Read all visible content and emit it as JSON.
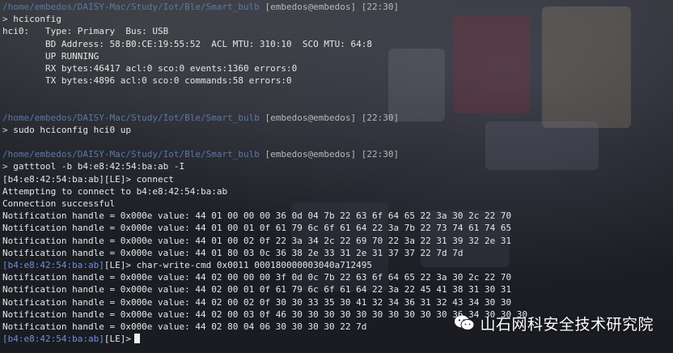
{
  "terminal": {
    "lines": [
      {
        "type": "path",
        "path": "/home/embedos/DAISY-Mac/Study/Iot/Ble/Smart_bulb",
        "host": "[embedos@embedos]",
        "time": "[22:30]"
      },
      {
        "type": "cmd",
        "prompt": ">",
        "command": " hciconfig"
      },
      {
        "type": "out",
        "text": "hci0:   Type: Primary  Bus: USB"
      },
      {
        "type": "out",
        "text": "        BD Address: 58:B0:CE:19:55:52  ACL MTU: 310:10  SCO MTU: 64:8"
      },
      {
        "type": "out",
        "text": "        UP RUNNING"
      },
      {
        "type": "out",
        "text": "        RX bytes:46417 acl:0 sco:0 events:1360 errors:0"
      },
      {
        "type": "out",
        "text": "        TX bytes:4896 acl:0 sco:0 commands:58 errors:0"
      },
      {
        "type": "blank"
      },
      {
        "type": "blank"
      },
      {
        "type": "path",
        "path": "/home/embedos/DAISY-Mac/Study/Iot/Ble/Smart_bulb",
        "host": "[embedos@embedos]",
        "time": "[22:30]"
      },
      {
        "type": "cmd",
        "prompt": ">",
        "command": " sudo hciconfig hci0 up"
      },
      {
        "type": "blank"
      },
      {
        "type": "path",
        "path": "/home/embedos/DAISY-Mac/Study/Iot/Ble/Smart_bulb",
        "host": "[embedos@embedos]",
        "time": "[22:30]"
      },
      {
        "type": "cmd",
        "prompt": ">",
        "command": " gatttool -b b4:e8:42:54:ba:ab -I"
      },
      {
        "type": "out",
        "text": "[b4:e8:42:54:ba:ab][LE]> connect"
      },
      {
        "type": "out",
        "text": "Attempting to connect to b4:e8:42:54:ba:ab"
      },
      {
        "type": "out",
        "text": "Connection successful"
      },
      {
        "type": "out",
        "text": "Notification handle = 0x000e value: 44 01 00 00 00 36 0d 04 7b 22 63 6f 64 65 22 3a 30 2c 22 70"
      },
      {
        "type": "out",
        "text": "Notification handle = 0x000e value: 44 01 00 01 0f 61 79 6c 6f 61 64 22 3a 7b 22 73 74 61 74 65"
      },
      {
        "type": "out",
        "text": "Notification handle = 0x000e value: 44 01 00 02 0f 22 3a 34 2c 22 69 70 22 3a 22 31 39 32 2e 31"
      },
      {
        "type": "out",
        "text": "Notification handle = 0x000e value: 44 01 80 03 0c 36 38 2e 33 31 2e 31 37 37 22 7d 7d"
      },
      {
        "type": "le",
        "ctx": "[b4:e8:42:54:ba:ab]",
        "suffix": "[LE]> char-write-cmd 0x0011 000180000003040a712495"
      },
      {
        "type": "out",
        "text": "Notification handle = 0x000e value: 44 02 00 00 00 3f 0d 0c 7b 22 63 6f 64 65 22 3a 30 2c 22 70"
      },
      {
        "type": "out",
        "text": "Notification handle = 0x000e value: 44 02 00 01 0f 61 79 6c 6f 61 64 22 3a 22 45 41 38 31 30 31"
      },
      {
        "type": "out",
        "text": "Notification handle = 0x000e value: 44 02 00 02 0f 30 30 33 35 30 41 32 34 36 31 32 43 34 30 30"
      },
      {
        "type": "out",
        "text": "Notification handle = 0x000e value: 44 02 00 03 0f 46 30 30 30 30 30 30 30 30 30 30 36 34 30 30 30"
      },
      {
        "type": "out",
        "text": "Notification handle = 0x000e value: 44 02 80 04 06 30 30 30 30 22 7d"
      },
      {
        "type": "le_cursor",
        "ctx": "[b4:e8:42:54:ba:ab]",
        "suffix": "[LE]>"
      }
    ]
  },
  "watermark": {
    "text": "山石网科安全技术研究院",
    "icon": "wechat-icon"
  },
  "colors": {
    "path": "#5a78a8",
    "le_context": "#6d8fd6",
    "text": "#e6e6e6"
  }
}
